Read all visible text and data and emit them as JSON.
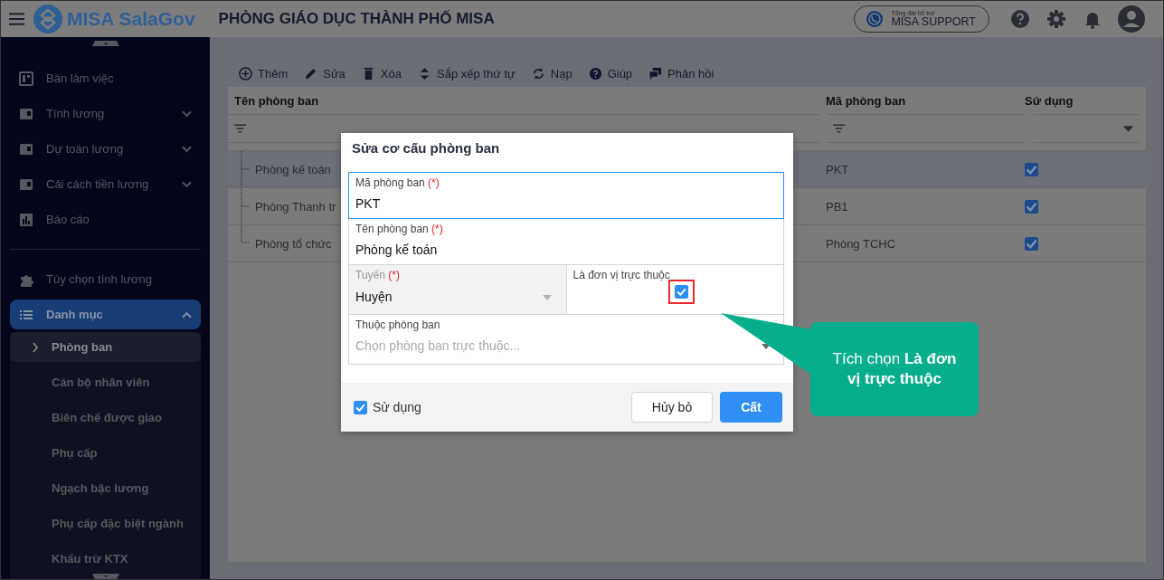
{
  "header": {
    "logo": "MISA SalaGov",
    "title": "PHÒNG GIÁO DỤC THÀNH PHỐ MISA",
    "support": {
      "caption": "Tổng đài hỗ trợ",
      "label": "MISA SUPPORT"
    }
  },
  "sidebar": {
    "sections": [
      {
        "items": [
          {
            "label": "Bàn làm việc",
            "kind": "link",
            "selected": false
          },
          {
            "label": "Tính lương",
            "kind": "group",
            "expanded": false,
            "selected": false
          },
          {
            "label": "Dự toán lương",
            "kind": "group",
            "expanded": false,
            "selected": false
          },
          {
            "label": "Cải cách tiền lương",
            "kind": "group",
            "expanded": false,
            "selected": false
          },
          {
            "label": "Báo cáo",
            "kind": "link",
            "selected": false
          }
        ]
      },
      {
        "items": [
          {
            "label": "Tùy chọn tính lương",
            "kind": "link",
            "selected": false
          },
          {
            "label": "Danh mục",
            "kind": "group",
            "expanded": true,
            "selected": true,
            "children": [
              {
                "label": "Phòng ban",
                "selected": true
              },
              {
                "label": "Cán bộ nhân viên",
                "selected": false
              },
              {
                "label": "Biên chế được giao",
                "selected": false
              },
              {
                "label": "Phụ cấp",
                "selected": false
              },
              {
                "label": "Ngạch bậc lương",
                "selected": false
              },
              {
                "label": "Phụ cấp đặc biệt ngành",
                "selected": false
              },
              {
                "label": "Khấu trừ KTX",
                "selected": false
              }
            ]
          }
        ]
      }
    ]
  },
  "toolbar": [
    "Thêm",
    "Sửa",
    "Xóa",
    "Sắp xếp thứ tự",
    "Nạp",
    "Giúp",
    "Phản hồi"
  ],
  "table": {
    "columns": [
      "Tên phòng ban",
      "Mã phòng ban",
      "Sử dụng"
    ],
    "rows": [
      {
        "name": "Phòng kế toán",
        "code": "PKT",
        "used": true,
        "selected": true
      },
      {
        "name": "Phòng Thanh tr",
        "code": "PB1",
        "used": true,
        "selected": false
      },
      {
        "name": "Phòng tổ chức",
        "code": "Phòng TCHC",
        "used": true,
        "selected": false
      }
    ]
  },
  "dialog": {
    "title": "Sửa cơ cấu phòng ban",
    "code": {
      "label": "Mã phòng ban",
      "required": "(*)",
      "value": "PKT",
      "focused": true
    },
    "name": {
      "label": "Tên phòng ban",
      "required": "(*)",
      "value": "Phòng kế toán"
    },
    "line": {
      "label": "Tuyến",
      "required": "(*)",
      "value": "Huyện",
      "disabled": true
    },
    "subordinate": {
      "label": "Là đơn vị trực thuộc",
      "checked": true,
      "highlighted": true
    },
    "parent": {
      "label": "Thuộc phòng ban",
      "placeholder": "Chọn phòng ban trực thuộc..."
    },
    "active": {
      "label": "Sử dụng",
      "checked": true
    },
    "cancel": "Hủy bỏ",
    "save": "Cất"
  },
  "callout": {
    "text": "Tích chọn **Là đơn vị trực thuộc**"
  }
}
